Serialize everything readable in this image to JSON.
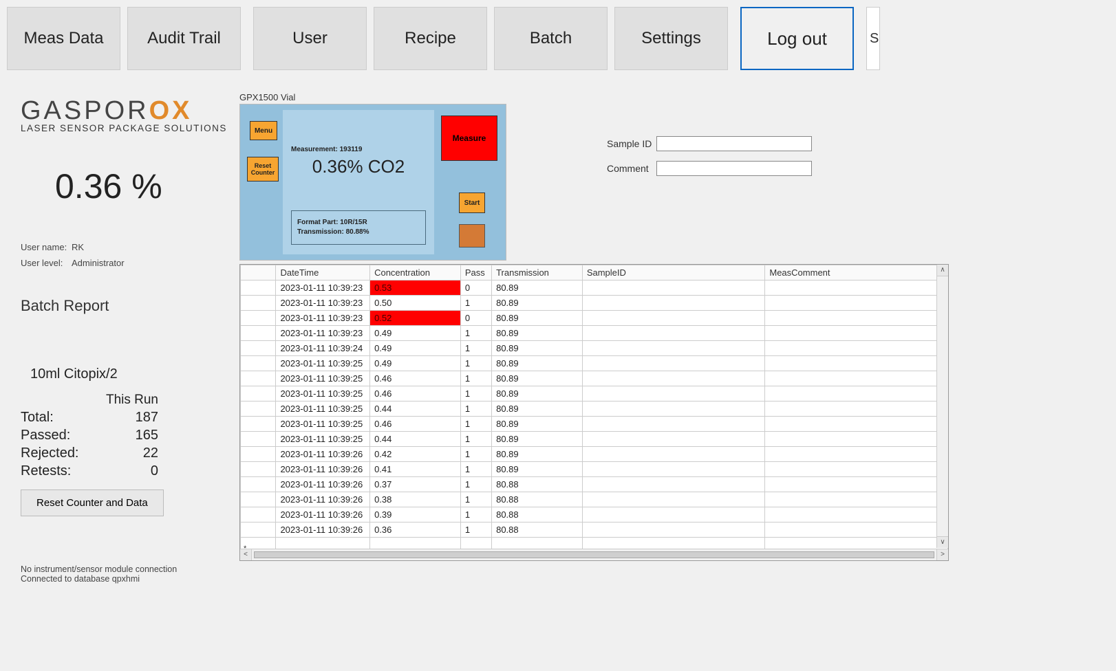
{
  "nav": {
    "meas_data": "Meas Data",
    "audit_trail": "Audit Trail",
    "user": "User",
    "recipe": "Recipe",
    "batch": "Batch",
    "settings": "Settings",
    "logout": "Log out",
    "partial": "S"
  },
  "logo": {
    "brand_a": "GASPOR",
    "brand_b": "OX",
    "tagline": "LASER SENSOR PACKAGE SOLUTIONS"
  },
  "main_reading": "0.36  %",
  "user": {
    "name_label": "User name:",
    "name_value": "RK",
    "level_label": "User level:",
    "level_value": "Administrator"
  },
  "batch": {
    "title": "Batch Report",
    "name": "10ml Citopix/2",
    "this_run": "This Run",
    "rows": {
      "total_lbl": "Total:",
      "total_val": "187",
      "passed_lbl": "Passed:",
      "passed_val": "165",
      "rejected_lbl": "Rejected:",
      "rejected_val": "22",
      "retests_lbl": "Retests:",
      "retests_val": "0"
    },
    "reset_btn": "Reset Counter and Data"
  },
  "status": {
    "line1": "No instrument/sensor module connection",
    "line2": "Connected to database qpxhmi"
  },
  "device": {
    "title": "GPX1500 Vial",
    "menu": "Menu",
    "reset_counter": "Reset Counter",
    "meas_num": "Measurement: 193119",
    "reading": "0.36% CO2",
    "format_part": "Format Part: 10R/15R",
    "transmission": "Transmission: 80.88%",
    "measure": "Measure",
    "start": "Start"
  },
  "inputs": {
    "sample_id_lbl": "Sample ID",
    "sample_id_val": "",
    "comment_lbl": "Comment",
    "comment_val": ""
  },
  "table": {
    "headers": {
      "datetime": "DateTime",
      "concentration": "Concentration",
      "pass": "Pass",
      "transmission": "Transmission",
      "sample_id": "SampleID",
      "meas_comment": "MeasComment"
    },
    "rows": [
      {
        "dt": "2023-01-11 10:39:23",
        "conc": "0.53",
        "pass": "0",
        "trans": "80.89",
        "sid": "",
        "cmnt": "",
        "fail": true
      },
      {
        "dt": "2023-01-11 10:39:23",
        "conc": "0.50",
        "pass": "1",
        "trans": "80.89",
        "sid": "",
        "cmnt": "",
        "fail": false
      },
      {
        "dt": "2023-01-11 10:39:23",
        "conc": "0.52",
        "pass": "0",
        "trans": "80.89",
        "sid": "",
        "cmnt": "",
        "fail": true
      },
      {
        "dt": "2023-01-11 10:39:23",
        "conc": "0.49",
        "pass": "1",
        "trans": "80.89",
        "sid": "",
        "cmnt": "",
        "fail": false
      },
      {
        "dt": "2023-01-11 10:39:24",
        "conc": "0.49",
        "pass": "1",
        "trans": "80.89",
        "sid": "",
        "cmnt": "",
        "fail": false
      },
      {
        "dt": "2023-01-11 10:39:25",
        "conc": "0.49",
        "pass": "1",
        "trans": "80.89",
        "sid": "",
        "cmnt": "",
        "fail": false
      },
      {
        "dt": "2023-01-11 10:39:25",
        "conc": "0.46",
        "pass": "1",
        "trans": "80.89",
        "sid": "",
        "cmnt": "",
        "fail": false
      },
      {
        "dt": "2023-01-11 10:39:25",
        "conc": "0.46",
        "pass": "1",
        "trans": "80.89",
        "sid": "",
        "cmnt": "",
        "fail": false
      },
      {
        "dt": "2023-01-11 10:39:25",
        "conc": "0.44",
        "pass": "1",
        "trans": "80.89",
        "sid": "",
        "cmnt": "",
        "fail": false
      },
      {
        "dt": "2023-01-11 10:39:25",
        "conc": "0.46",
        "pass": "1",
        "trans": "80.89",
        "sid": "",
        "cmnt": "",
        "fail": false
      },
      {
        "dt": "2023-01-11 10:39:25",
        "conc": "0.44",
        "pass": "1",
        "trans": "80.89",
        "sid": "",
        "cmnt": "",
        "fail": false
      },
      {
        "dt": "2023-01-11 10:39:26",
        "conc": "0.42",
        "pass": "1",
        "trans": "80.89",
        "sid": "",
        "cmnt": "",
        "fail": false
      },
      {
        "dt": "2023-01-11 10:39:26",
        "conc": "0.41",
        "pass": "1",
        "trans": "80.89",
        "sid": "",
        "cmnt": "",
        "fail": false
      },
      {
        "dt": "2023-01-11 10:39:26",
        "conc": "0.37",
        "pass": "1",
        "trans": "80.88",
        "sid": "",
        "cmnt": "",
        "fail": false
      },
      {
        "dt": "2023-01-11 10:39:26",
        "conc": "0.38",
        "pass": "1",
        "trans": "80.88",
        "sid": "",
        "cmnt": "",
        "fail": false
      },
      {
        "dt": "2023-01-11 10:39:26",
        "conc": "0.39",
        "pass": "1",
        "trans": "80.88",
        "sid": "",
        "cmnt": "",
        "fail": false
      },
      {
        "dt": "2023-01-11 10:39:26",
        "conc": "0.36",
        "pass": "1",
        "trans": "80.88",
        "sid": "",
        "cmnt": "",
        "fail": false
      }
    ],
    "new_row_marker": "*"
  }
}
